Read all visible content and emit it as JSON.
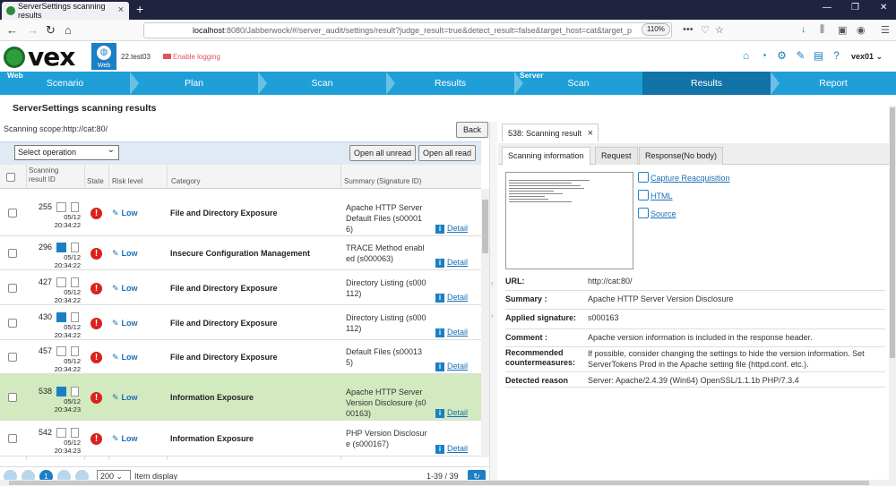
{
  "browser": {
    "tab_title": "ServerSettings scanning results",
    "url_host": "localhost",
    "url_rest": ":8080/Jabberwock/#/server_audit/settings/result?judge_result=true&detect_result=false&target_host=cat&target_p",
    "zoom": "110%"
  },
  "app": {
    "logo": "vex",
    "badge": "Web",
    "target": "22.test03",
    "logging": "Enable logging",
    "user": "vex01"
  },
  "steps": {
    "group_web": "Web",
    "group_server": "Server",
    "web": [
      "Scenario",
      "Plan",
      "Scan",
      "Results"
    ],
    "server": [
      "Scan",
      "Results",
      "Report"
    ]
  },
  "page": {
    "title": "ServerSettings scanning results",
    "scope": "Scanning scope:http://cat:80/",
    "back": "Back",
    "select_operation": "Select operation",
    "open_unread": "Open all unread",
    "open_read": "Open all read"
  },
  "table": {
    "headers": {
      "id": "Scanning result ID",
      "state": "State",
      "risk": "Risk level",
      "category": "Category",
      "summary": "Summary (Signature ID)"
    },
    "detail_label": "Detail",
    "rows": [
      {
        "id": "255",
        "date": "05/12",
        "time": "20:34:22",
        "level": "Low",
        "category": "File and Directory Exposure",
        "summary": "Apache HTTP Server Default Files (s000016)"
      },
      {
        "id": "296",
        "date": "05/12",
        "time": "20:34:22",
        "level": "Low",
        "category": "Insecure Configuration Management",
        "summary": "TRACE Method enabled (s000063)"
      },
      {
        "id": "427",
        "date": "05/12",
        "time": "20:34:22",
        "level": "Low",
        "category": "File and Directory Exposure",
        "summary": "Directory Listing (s000112)"
      },
      {
        "id": "430",
        "date": "05/12",
        "time": "20:34:22",
        "level": "Low",
        "category": "File and Directory Exposure",
        "summary": "Directory Listing (s000112)"
      },
      {
        "id": "457",
        "date": "05/12",
        "time": "20:34:22",
        "level": "Low",
        "category": "File and Directory Exposure",
        "summary": "Default Files (s000135)"
      },
      {
        "id": "538",
        "date": "05/12",
        "time": "20:34:23",
        "level": "Low",
        "category": "Information Exposure",
        "summary": "Apache HTTP Server Version Disclosure (s000163)"
      },
      {
        "id": "542",
        "date": "05/12",
        "time": "20:34:23",
        "level": "Low",
        "category": "Information Exposure",
        "summary": "PHP Version Disclosure (s000167)"
      }
    ]
  },
  "pager": {
    "page": "1",
    "page_size": "200",
    "item_display": "Item display",
    "range": "1-39 / 39"
  },
  "detail": {
    "tab": "538: Scanning result",
    "subtabs": [
      "Scanning information",
      "Request",
      "Response(No body)"
    ],
    "links": [
      "Capture Reacquisition",
      "HTML",
      "Source"
    ],
    "fields": [
      {
        "k": "URL:",
        "v": "http://cat:80/"
      },
      {
        "k": "Summary :",
        "v": "Apache HTTP Server Version Disclosure"
      },
      {
        "k": "Applied signature:",
        "v": "s000163"
      },
      {
        "k": "Comment :",
        "v": "Apache version information is included in the response header."
      },
      {
        "k": "Recommended countermeasures:",
        "v": "If possible, consider changing the settings to hide the version information. Set ServerTokens Prod in the Apache setting file (httpd.conf. etc.)."
      },
      {
        "k": "Detected reason",
        "v": "Server: Apache/2.4.39 (Win64) OpenSSL/1.1.1b PHP/7.3.4"
      }
    ]
  },
  "colors": {
    "accent": "#1e9fd8",
    "active_step": "#1273a6",
    "risk": "#d9221c",
    "selected_row": "#d3eac0"
  }
}
